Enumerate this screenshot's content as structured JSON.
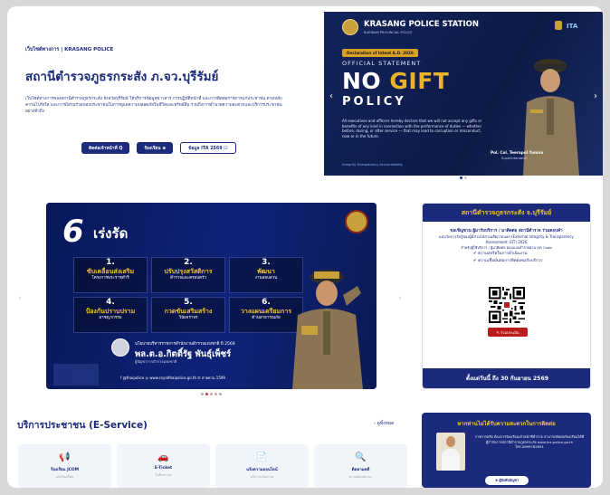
{
  "breadcrumb": "เว็บไซต์ทางการ | KRASANG POLICE",
  "page_title": "สถานีตำรวจภูธรกระสัง ภ.จว.บุรีรัมย์",
  "description": "เว็บไซต์ทางการของสถานีตำรวจภูธรกระสัง จังหวัดบุรีรัมย์ ให้บริการข้อมูลข่าวสาร การปฏิบัติหน้าที่ และการติดต่อราชการแก่ประชาชน ตามหลักความโปร่งใส และการมีส่วนร่วมของประชาชนในการดูแลความปลอดภัยในชีวิตและทรัพย์สิน รวมถึงการอำนวยความสะดวกและบริการประชาชนอย่างทั่วถึง",
  "buttons": {
    "contact": "ติดต่อเจ้าหน้าที่ Q",
    "complaint": "ร้องเรียน ⊕",
    "ita": "ข้อมูล ITA 2569 ☑"
  },
  "hero": {
    "station": "KRASANG POLICE STATION",
    "station_sub": "BURIRAM PROVINCIAL POLICE",
    "ita": "ITA",
    "declaration": "Declaration of Intent A.D. 2026",
    "official": "OFFICIAL STATEMENT",
    "no": "NO ",
    "gift": "GIFT",
    "policy": "POLICY",
    "body": "All executives and officers hereby declare that we will not accept any gifts or benefits of any kind in connection with the performance of duties — whether before, during, or after service — that may lead to corruption or misconduct, now or in the future.",
    "tags": "Integrity  Transparency  Accountability",
    "signer": "Pol. Col. Teerapol Yomna",
    "signer_role": "Superintendent"
  },
  "panel": {
    "six": "6",
    "title": "เร่งรัด",
    "items": [
      {
        "n": "1.",
        "t": "ขับเคลื่อนส่งเสริม",
        "s": "โครงการพระราชดำริ"
      },
      {
        "n": "2.",
        "t": "ปรับปรุงสวัสดิการ",
        "s": "ตำรวจและครอบครัว"
      },
      {
        "n": "3.",
        "t": "พัฒนา",
        "s": "งานสอบสวน"
      },
      {
        "n": "4.",
        "t": "ป้องกันปราบปราม",
        "s": "อาชญากรรม"
      },
      {
        "n": "5.",
        "t": "กวดขันเสริมสร้าง",
        "s": "วินัยจราจร"
      },
      {
        "n": "6.",
        "t": "วางแผนเตรียมการ",
        "s": "ด้านสาธารณภัย"
      }
    ],
    "cmd_label": "นโยบายบริหารราชการสำนักงานตำรวจแห่งชาติ ปี 2569",
    "cmd_name": "พล.ต.อ.กิตติ์รัฐ พันธุ์เพ็ชร์",
    "cmd_pos": "ผู้บัญชาการตำรวจแห่งชาติ",
    "socials": "f @thaipolice   ◎ www.royalthaipolice.go.th   ✆ สายด่วน 1599"
  },
  "card": {
    "header": "สถานีตำรวจภูธรกระสัง จ.บุรีรัมย์",
    "line1": "ขอเชิญชวน ผู้มารับบริการ / มาติดต่อ สถานีตำรวจ ร่วมตอบคำ",
    "line2": "แบบวัดการรับรู้ของผู้มีส่วนได้ส่วนเสียภายนอก (External Integrity & Transparency Assessment: EIT) 2026",
    "line3": "สำหรับผู้ใช้บริการ / ผู้มาติดต่อ ตอบแบบสำรวจผ่าน QR Code",
    "check1": "ความสุจริตในการดำเนินงาน",
    "check2": "ความเชื่อมั่นต่อการติดต่อขอรับบริการ",
    "red_btn": "✎ ร่วมประเมิน",
    "footer": "ตั้งแต่วันนี้ ถึง 30 กันยายน 2569"
  },
  "eservice": {
    "heading": "บริการประชาชน (E-Service)",
    "see_all": "› ดูทั้งหมด",
    "tiles": [
      {
        "icon": "megaphone-icon",
        "glyph": "📢",
        "label": "ร้องเรียน JCOM",
        "sub": "แจ้งร้องเรียน"
      },
      {
        "icon": "car-icon",
        "glyph": "🚗",
        "label": "E-Ticket",
        "sub": "ใบสั่งจราจร"
      },
      {
        "icon": "document-icon",
        "glyph": "📄",
        "label": "แจ้งความออนไลน์",
        "sub": "บริการแจ้งความ"
      },
      {
        "icon": "search-icon",
        "glyph": "🔍",
        "label": "ติดตามคดี",
        "sub": "ตรวจสอบสถานะ"
      }
    ]
  },
  "recommend": {
    "title": "หากท่านไม่ได้รับความสะดวกในการติดต่อ",
    "text": "ราชการหรือ ต้องการร้องเรียนเจ้าหน้าที่ตำรวจ สามารถติดต่อร้องเรียนได้ที่ ผู้กำกับการสถานีตำรวจภูธรกระสัง www.krs.police.go.th โทร.0899782691",
    "btn": "⊕ ผู้บังคับบัญชา"
  },
  "colors": {
    "brand": "#1b2a7a",
    "accent": "#f3c233",
    "red": "#b81c1c"
  }
}
